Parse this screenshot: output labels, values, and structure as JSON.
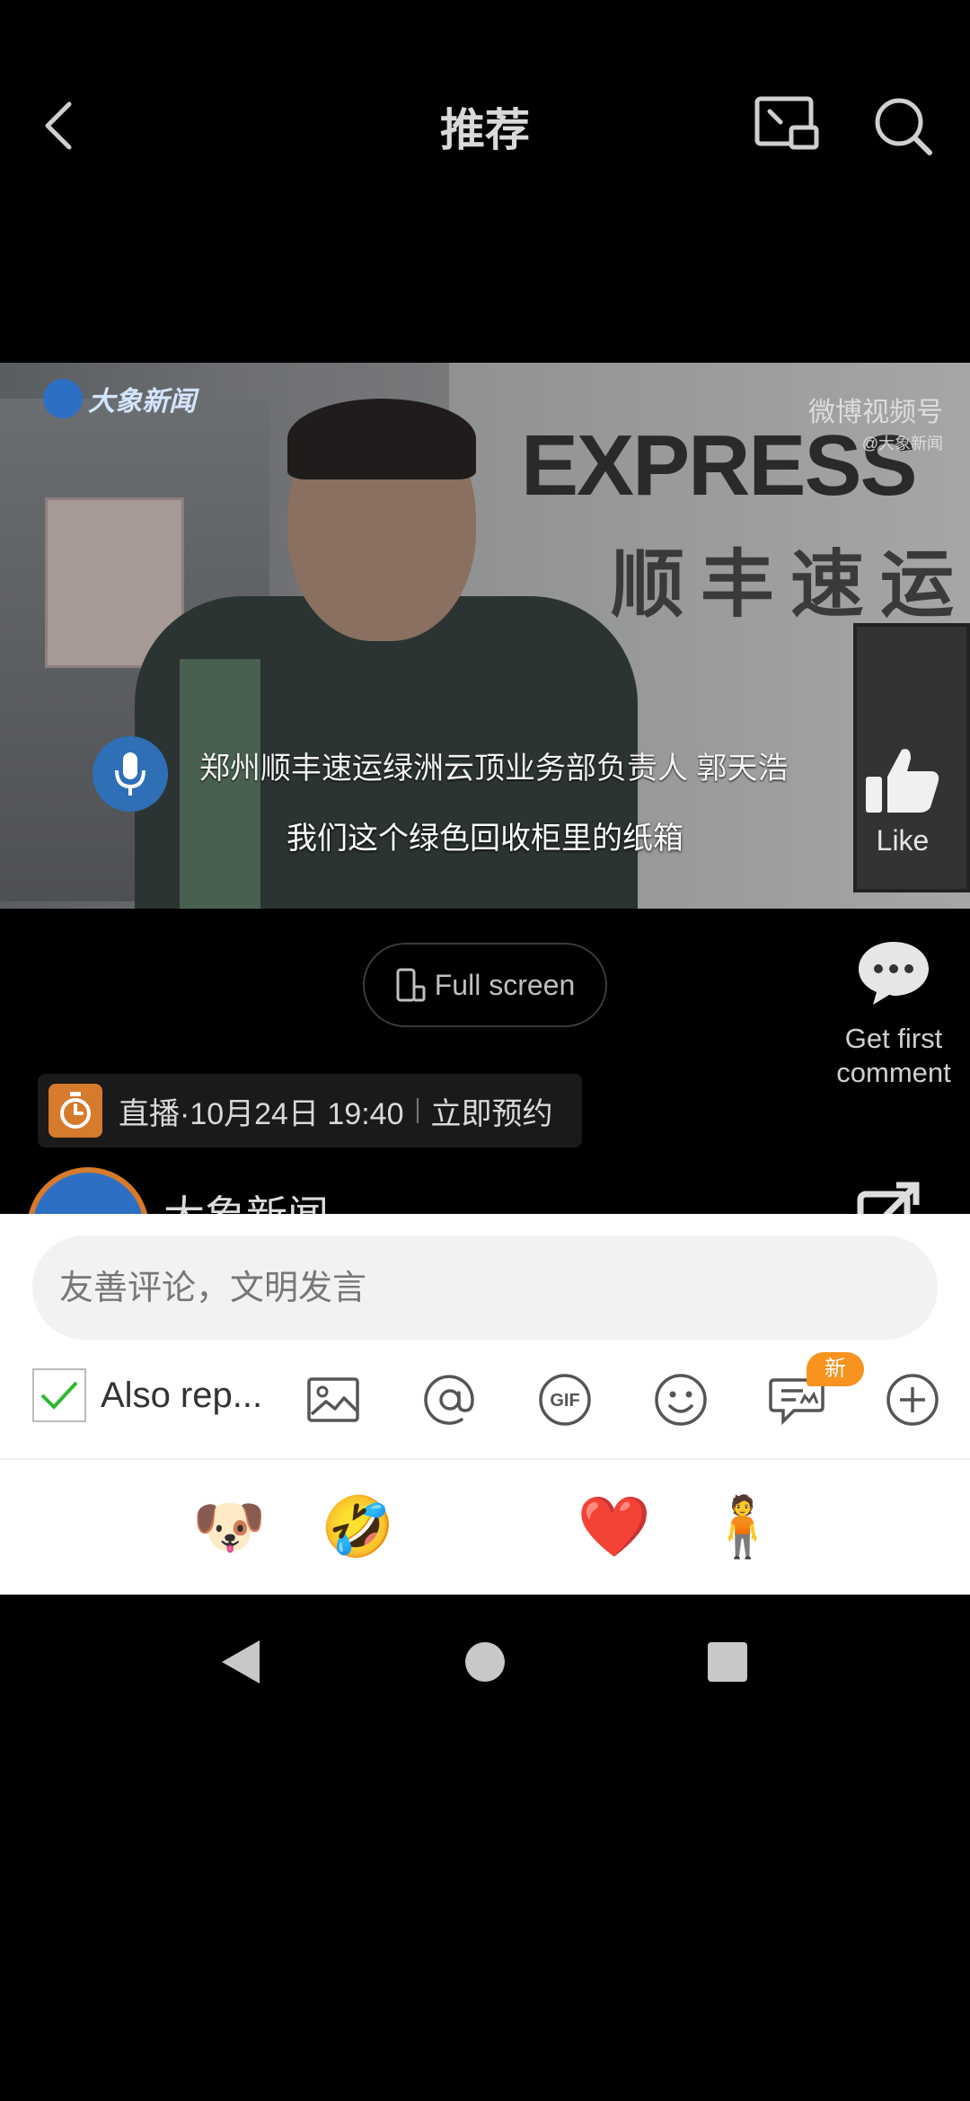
{
  "header": {
    "title": "推荐",
    "icons": [
      "back-icon",
      "pip-icon",
      "search-icon"
    ]
  },
  "video": {
    "brand_logo": "大象新闻",
    "watermark_main": "微博视频号",
    "watermark_sub": "@大象新闻",
    "sign_en": "EXPRESS",
    "sign_cn": "顺丰速运",
    "caption_name": "郑州顺丰速运绿洲云顶业务部负责人 郭天浩",
    "caption_line": "我们这个绿色回收柜里的纸箱",
    "like_label": "Like"
  },
  "controls": {
    "fullscreen_label": "Full screen",
    "comment_label_1": "Get first",
    "comment_label_2": "comment"
  },
  "live": {
    "text": "直播·10月24日 19:40",
    "cta": "立即预约"
  },
  "channel": {
    "name": "大象新闻"
  },
  "comment_sheet": {
    "input_placeholder": "友善评论，文明发言",
    "repost_label": "Also rep...",
    "repost_checked": true,
    "new_badge": "新",
    "tool_icons": [
      "image-icon",
      "mention-icon",
      "gif-icon",
      "smiley-icon",
      "superfans-chat-icon",
      "add-icon"
    ],
    "emojis": [
      "😭",
      "🐶",
      "🤣",
      "😆",
      "❤️",
      "🧍",
      "😂"
    ]
  },
  "colors": {
    "accent_orange": "#f7931e",
    "check_green": "#2eb82e",
    "brand_blue": "#2d6fc4"
  }
}
